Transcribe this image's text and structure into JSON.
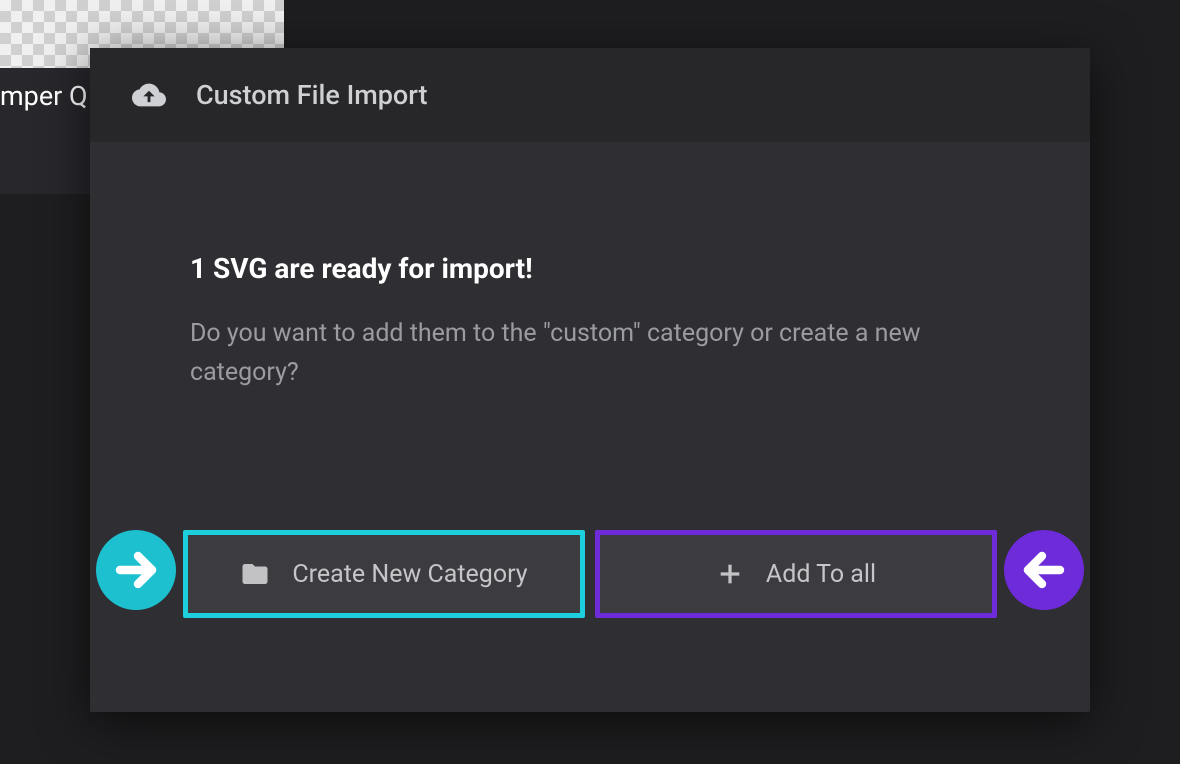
{
  "background": {
    "partial_label": "mper Q"
  },
  "modal": {
    "title": "Custom File Import",
    "headline": "1 SVG are ready for import!",
    "description": "Do you want to add them to the \"custom\" category or create a new category?",
    "buttons": {
      "create": "Create New Category",
      "addAll": "Add To all"
    }
  },
  "icons": {
    "cloud": "cloud-upload-icon",
    "folder": "folder-icon",
    "plus": "plus-icon",
    "arrow_right": "arrow-right-icon",
    "arrow_left": "arrow-left-icon"
  },
  "colors": {
    "teal": "#1dcfdc",
    "purple": "#6d2bd9",
    "panel": "#2e2e33"
  }
}
